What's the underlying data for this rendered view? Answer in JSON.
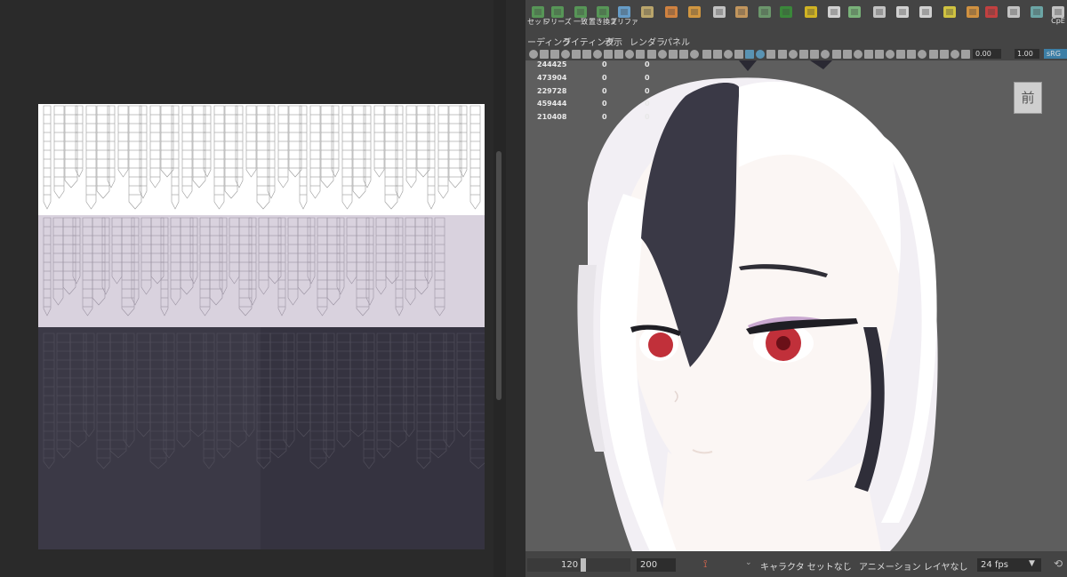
{
  "shelf": {
    "buttons": [
      {
        "label": "セット",
        "icon": "joint-set-icon"
      },
      {
        "label": "フリーズ",
        "icon": "freeze-icon"
      },
      {
        "label": "一致",
        "icon": "match-icon"
      },
      {
        "label": "置き換え",
        "icon": "replace-icon"
      },
      {
        "label": "ブリファ",
        "icon": "preference-icon"
      },
      {
        "label": "",
        "icon": "uv-layout-icon"
      },
      {
        "label": "",
        "icon": "cube-unfold-icon"
      },
      {
        "label": "",
        "icon": "cube-burst-icon"
      },
      {
        "label": "",
        "icon": "plane-add-icon"
      },
      {
        "label": "",
        "icon": "quad-grid-icon"
      },
      {
        "label": "",
        "icon": "stack-icon"
      },
      {
        "label": "",
        "icon": "checker-icon"
      },
      {
        "label": "",
        "icon": "excel-icon"
      },
      {
        "label": "",
        "icon": "symmetry-icon"
      },
      {
        "label": "",
        "icon": "circle-icon"
      },
      {
        "label": "",
        "icon": "node-graph-icon"
      },
      {
        "label": "",
        "icon": "list-icon"
      },
      {
        "label": "",
        "icon": "outliner-icon"
      },
      {
        "label": "",
        "icon": "curve-icon"
      },
      {
        "label": "",
        "icon": "box-icon"
      },
      {
        "label": "",
        "icon": "graph-editor-icon"
      },
      {
        "label": "",
        "icon": "hypergraph-icon"
      },
      {
        "label": "",
        "icon": "script-icon"
      },
      {
        "label": "CpE",
        "icon": "cpe-icon"
      }
    ]
  },
  "menubar": {
    "items": [
      "ーディング",
      "ライティング",
      "表示",
      "レンダラ",
      "パネル"
    ]
  },
  "viewtoolbar": {
    "exposure": "0.00",
    "gamma": "1.00",
    "colorspace": "sRG"
  },
  "hud": {
    "rows": [
      {
        "value": "244425",
        "a": "0",
        "b": "0"
      },
      {
        "value": "473904",
        "a": "0",
        "b": "0"
      },
      {
        "value": "229728",
        "a": "0",
        "b": "0"
      },
      {
        "value": "459444",
        "a": "0",
        "b": "0"
      },
      {
        "value": "210408",
        "a": "0",
        "b": "0"
      }
    ]
  },
  "viewcube": {
    "face": "前"
  },
  "timebar": {
    "current_end": "120",
    "range_end": "200",
    "character_set": "キャラクタ セットなし",
    "anim_layer": "アニメーション レイヤなし",
    "fps": "24 fps"
  },
  "colors": {
    "viewport_bg": "#5e5e5e",
    "hair": "#f5f3f6",
    "hair_dark": "#3a3946",
    "skin": "#fbf6f4",
    "eye": "#c1303a",
    "uv_white": "#ffffff",
    "uv_lavender": "#d9d2de",
    "uv_dark": "#393744"
  }
}
